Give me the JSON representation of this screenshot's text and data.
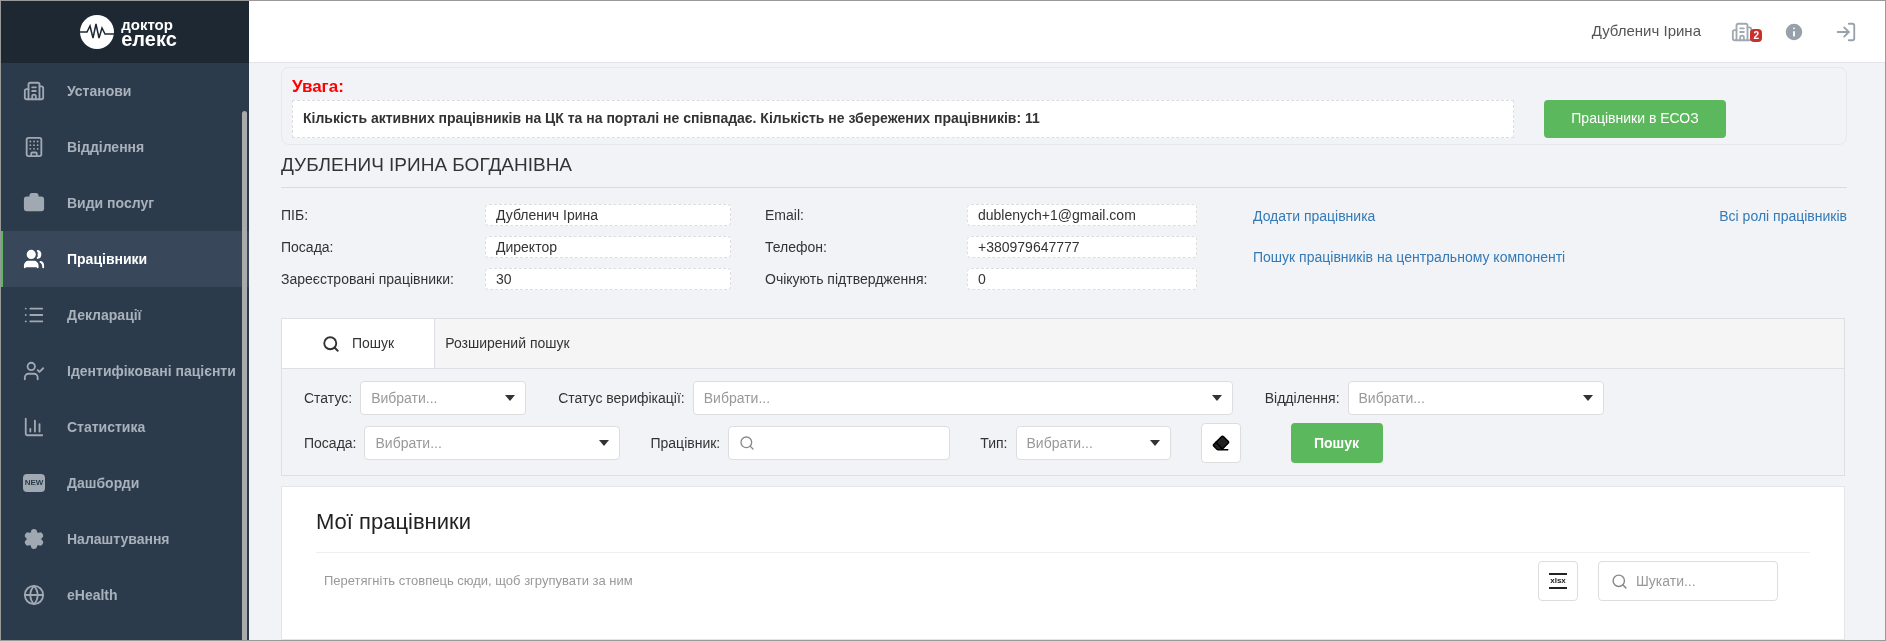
{
  "logo": {
    "line_1": "доктор",
    "line_2": "елекс"
  },
  "sidebar": {
    "items": [
      {
        "label": "Установи",
        "selected": false
      },
      {
        "label": "Відділення",
        "selected": false
      },
      {
        "label": "Види послуг",
        "selected": false
      },
      {
        "label": "Працівники",
        "selected": true
      },
      {
        "label": "Декларації",
        "selected": false
      },
      {
        "label": "Ідентифіковані пацієнти",
        "selected": false
      },
      {
        "label": "Статистика",
        "selected": false
      },
      {
        "label": "Дашборди",
        "selected": false,
        "icon_text": "NEW"
      },
      {
        "label": "Налаштування",
        "selected": false
      },
      {
        "label": "eHealth",
        "selected": false
      }
    ]
  },
  "header": {
    "user_name": "Дубленич Ірина",
    "notification_count": "2"
  },
  "alert": {
    "title": "Увага:",
    "message": "Кількість активних працівників на ЦК та на порталі не співпадає. Кількість не збережених працівників: 11",
    "button": "Працівники в ЕСОЗ"
  },
  "profile": {
    "name": "ДУБЛЕНИЧ ІРИНА БОГДАНІВНА",
    "fields": [
      {
        "label": "ПІБ:",
        "value": "Дубленич Ірина"
      },
      {
        "label": "Email:",
        "value": "dublenych+1@gmail.com"
      },
      {
        "label": "Посада:",
        "value": "Директор"
      },
      {
        "label": "Телефон:",
        "value": "+380979647777"
      },
      {
        "label": "Зареєстровані працівники:",
        "value": "30"
      },
      {
        "label": "Очікують підтвердження:",
        "value": "0"
      }
    ],
    "links": [
      "Додати працівника",
      "Всі ролі працівників",
      "Пошук працівників на центральному компоненті"
    ]
  },
  "search_panel": {
    "tabs": [
      {
        "label": "Пошук",
        "selected": true
      },
      {
        "label": "Розширений пошук",
        "selected": false
      }
    ],
    "filter_rows": [
      [
        {
          "label": "Статус:",
          "kind": "select",
          "placeholder": "Вибрати..."
        },
        {
          "label": "Статус верифікації:",
          "kind": "select",
          "placeholder": "Вибрати..."
        },
        {
          "label": "Відділення:",
          "kind": "select",
          "placeholder": "Вибрати..."
        }
      ],
      [
        {
          "label": "Посада:",
          "kind": "select",
          "placeholder": "Вибрати..."
        },
        {
          "label": "Працівник:",
          "kind": "search"
        },
        {
          "label": "Тип:",
          "kind": "select",
          "placeholder": "Вибрати..."
        }
      ]
    ],
    "search_button": "Пошук"
  },
  "employees": {
    "title": "Мої працівники",
    "group_hint": "Перетягніть стовпець сюди, щоб згрупувати за ним",
    "export_label": "xlsx",
    "search_placeholder": "Шукати..."
  }
}
